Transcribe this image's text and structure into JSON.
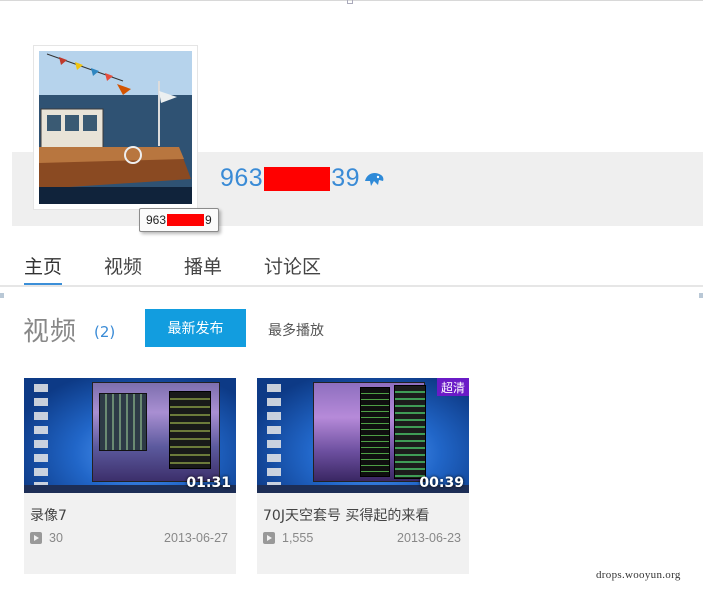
{
  "profile": {
    "username_prefix": "963",
    "username_suffix": "39",
    "tooltip_prefix": "963",
    "tooltip_suffix": "9",
    "verified_icon": "bird-icon"
  },
  "tabs": [
    {
      "label": "主页",
      "active": true
    },
    {
      "label": "视频",
      "active": false
    },
    {
      "label": "播单",
      "active": false
    },
    {
      "label": "讨论区",
      "active": false
    }
  ],
  "videos_section": {
    "title": "视频",
    "count": "(2)",
    "sort_active": "最新发布",
    "sort_other": "最多播放"
  },
  "videos": [
    {
      "title": "录像7",
      "duration": "01:31",
      "plays": "30",
      "date": "2013-06-27",
      "badge": ""
    },
    {
      "title": "70J天空套号 买得起的来看",
      "duration": "00:39",
      "plays": "1,555",
      "date": "2013-06-23",
      "badge": "超清"
    }
  ],
  "colors": {
    "accent": "#129ddf",
    "link": "#3a8bd6",
    "redaction": "#ff0000",
    "hd_badge": "#6a1bc7"
  },
  "watermark": "drops.wooyun.org"
}
